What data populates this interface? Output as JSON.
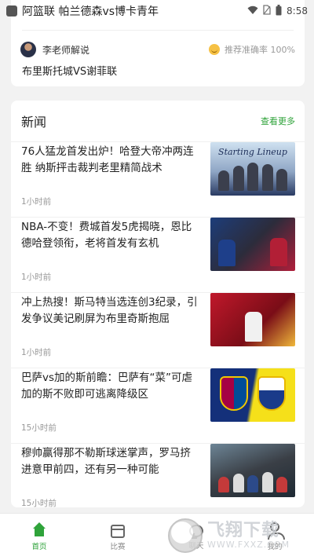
{
  "status_bar": {
    "match_label": "阿篮联 帕兰德森vs博卡青年",
    "time": "8:58"
  },
  "top_card": {
    "expert_name": "李老师解说",
    "accuracy_text": "推荐准确率 100%",
    "match_title": "布里斯托城VS谢菲联"
  },
  "news": {
    "section_title": "新闻",
    "see_more": "查看更多",
    "items": [
      {
        "title": "76人猛龙首发出炉！哈登大帝冲两连胜 纳斯抨击裁判老里精简战术",
        "time": "1小时前",
        "thumb_text": "Starting Lineup"
      },
      {
        "title": "NBA-不变！费城首发5虎揭晓，恩比德哈登领衔，老将首发有玄机",
        "time": "1小时前",
        "thumb_text": ""
      },
      {
        "title": "冲上热搜！斯马特当选连创3纪录，引发争议美记刷屏为布里奇斯抱屈",
        "time": "1小时前",
        "thumb_text": ""
      },
      {
        "title": "巴萨vs加的斯前瞻：巴萨有“菜”可虐 加的斯不败即可逃离降级区",
        "time": "15小时前",
        "thumb_text": ""
      },
      {
        "title": "穆帅赢得那不勒斯球迷掌声，罗马挤进意甲前四，还有另一种可能",
        "time": "15小时前",
        "thumb_text": ""
      }
    ]
  },
  "bottom_nav": {
    "home": "首页",
    "schedule": "比赛",
    "chat": "聊天",
    "mine": "我的"
  },
  "watermark": {
    "main": "飞翔下载",
    "sub": "WWW.FXXZ.COM"
  },
  "colors": {
    "accent": "#2fa33a",
    "background": "#f2f2f2"
  }
}
